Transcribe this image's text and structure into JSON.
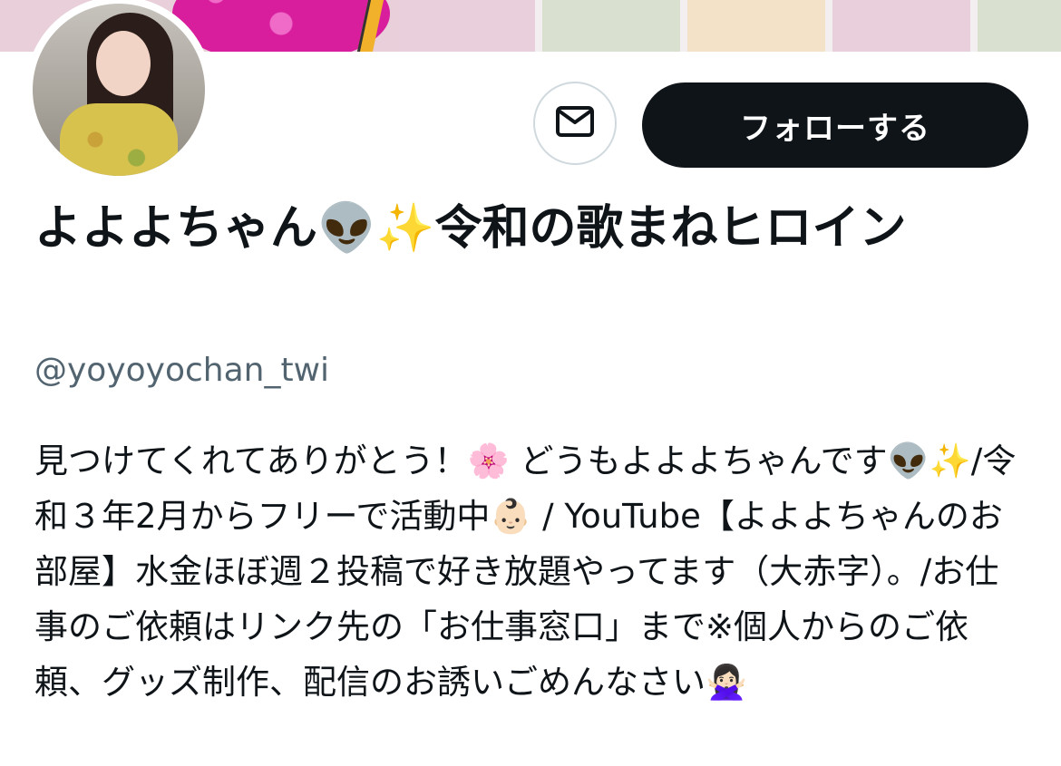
{
  "profile": {
    "display_name": "よよよちゃん👽✨令和の歌まねヒロイン",
    "handle": "@yoyoyochan_twi",
    "bio": "見つけてくれてありがとう！🌸 どうもよよよちゃんです👽✨/令和３年2月からフリーで活動中👶🏻 / YouTube【よよよちゃんのお部屋】水金ほぼ週２投稿で好き放題やってます（大赤字）。/お仕事のご依頼はリンク先の「お仕事窓口」まで※個人からのご依頼、グッズ制作、配信のお誘いごめんなさい🙅🏻‍♀️"
  },
  "actions": {
    "message_icon": "envelope-icon",
    "follow_label": "フォローする"
  },
  "colors": {
    "follow_button_bg": "#0f1419",
    "handle_text": "#536471"
  }
}
